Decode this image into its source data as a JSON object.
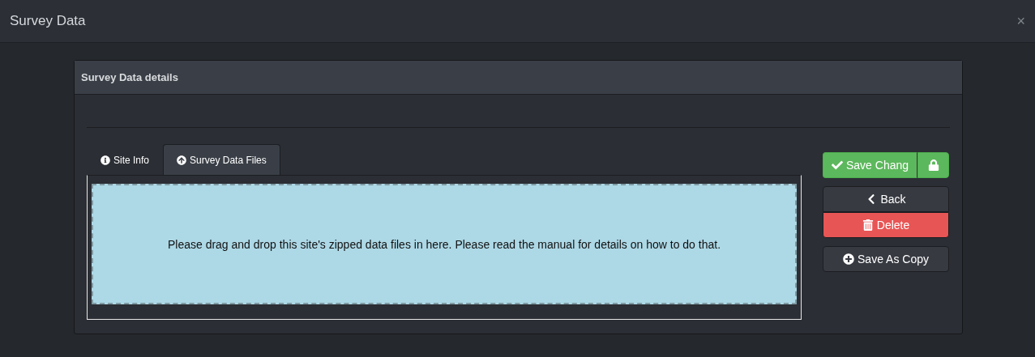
{
  "window": {
    "title": "Survey Data",
    "close": "×"
  },
  "panel": {
    "title": "Survey Data details",
    "tabs": [
      {
        "label": "Site Info",
        "kind": "info",
        "selected": false
      },
      {
        "label": "Survey Data Files",
        "kind": "upload",
        "selected": true
      }
    ],
    "dropzone": {
      "text": "Please drag and drop this site's zipped data files in here. Please read the manual for details on how to do that."
    },
    "buttons": [
      {
        "label": "Save Chang",
        "kind": "save"
      },
      {
        "label": "Back",
        "kind": "back"
      },
      {
        "label": "Delete",
        "kind": "delete"
      },
      {
        "label": "Save As Copy",
        "kind": "copy"
      }
    ]
  }
}
